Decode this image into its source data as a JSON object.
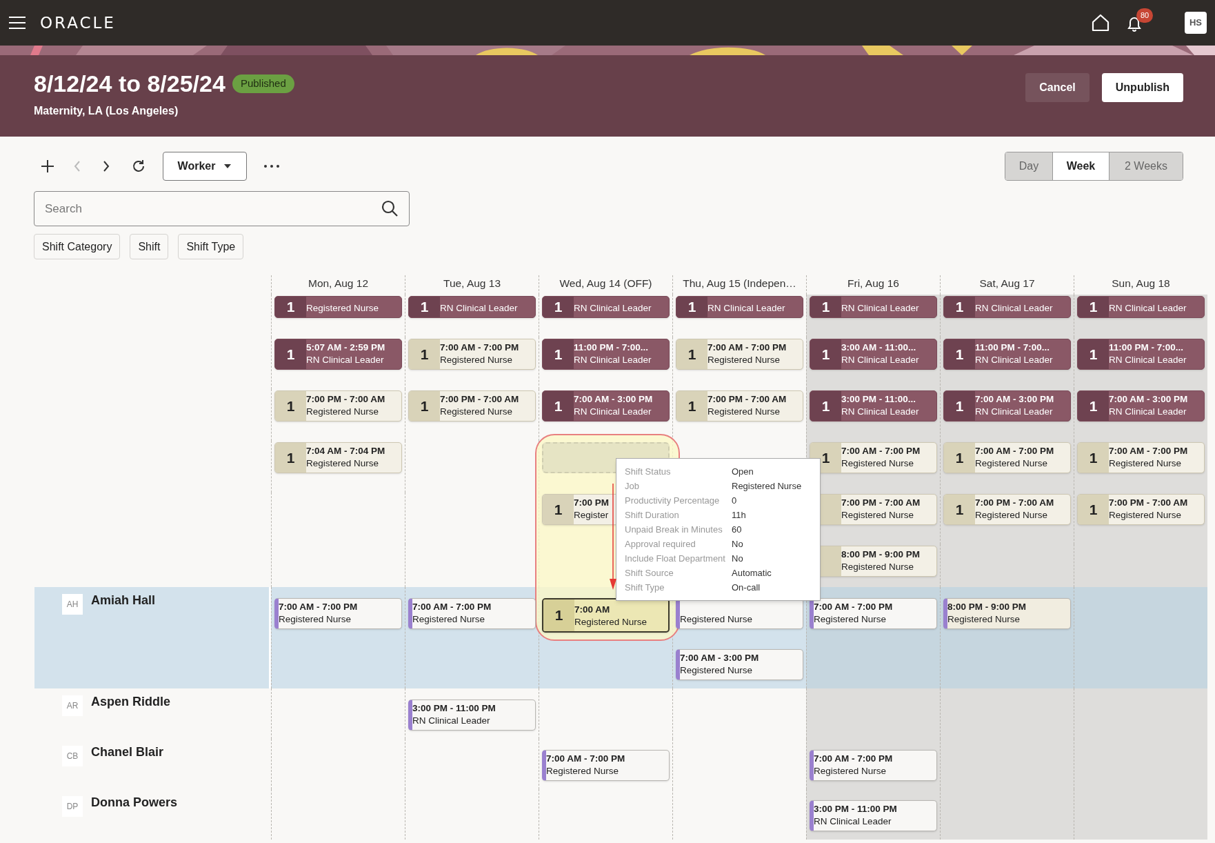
{
  "top_bar": {
    "logo": "ORACLE",
    "notifications": "80",
    "user_initials": "HS"
  },
  "header": {
    "title": "8/12/24 to 8/25/24",
    "status": "Published",
    "subtitle": "Maternity, LA (Los Angeles)",
    "actions": [
      {
        "label": "Cancel",
        "kind": "secondary"
      },
      {
        "label": "Unpublish",
        "kind": "primary"
      }
    ]
  },
  "toolbar": {
    "previous_disabled": true,
    "view_by": "Worker",
    "views": [
      {
        "label": "Day",
        "selected": false
      },
      {
        "label": "Week",
        "selected": true
      },
      {
        "label": "2 Weeks",
        "selected": false
      }
    ]
  },
  "search": {
    "placeholder": "Search"
  },
  "filters": [
    "Shift Category",
    "Shift",
    "Shift Type"
  ],
  "days": [
    {
      "label": "Mon, Aug 12",
      "shaded": false
    },
    {
      "label": "Tue, Aug 13",
      "shaded": false
    },
    {
      "label": "Wed, Aug 14 (OFF)",
      "shaded": false
    },
    {
      "label": "Thu, Aug 15 (Indepen…",
      "shaded": false
    },
    {
      "label": "Fri, Aug 16",
      "shaded": true
    },
    {
      "label": "Sat, Aug 17",
      "shaded": true
    },
    {
      "label": "Sun, Aug 18",
      "shaded": true
    }
  ],
  "open_shift_lanes": [
    {
      "cells": [
        {
          "kind": "leader",
          "count": "1",
          "job": "Registered Nurse"
        },
        {
          "kind": "leader",
          "count": "1",
          "job": "RN Clinical Leader"
        },
        {
          "kind": "leader",
          "count": "1",
          "job": "RN Clinical Leader"
        },
        {
          "kind": "leader",
          "count": "1",
          "job": "RN Clinical Leader"
        },
        {
          "kind": "leader",
          "count": "1",
          "job": "RN Clinical Leader"
        },
        {
          "kind": "leader",
          "count": "1",
          "job": "RN Clinical Leader"
        },
        {
          "kind": "leader",
          "count": "1",
          "job": "RN Clinical Leader"
        }
      ]
    },
    {
      "cells": [
        {
          "kind": "leader",
          "count": "1",
          "time": "5:07 AM - 2:59 PM",
          "job": "RN Clinical Leader"
        },
        {
          "kind": "nurse",
          "count": "1",
          "time": "7:00 AM - 7:00 PM",
          "job": "Registered Nurse"
        },
        {
          "kind": "leader",
          "count": "1",
          "time": "11:00 PM - 7:00...",
          "job": "RN Clinical Leader"
        },
        {
          "kind": "nurse",
          "count": "1",
          "time": "7:00 AM - 7:00 PM",
          "job": "Registered Nurse"
        },
        {
          "kind": "leader",
          "count": "1",
          "time": "3:00 AM - 11:00...",
          "job": "RN Clinical Leader"
        },
        {
          "kind": "leader",
          "count": "1",
          "time": "11:00 PM - 7:00...",
          "job": "RN Clinical Leader"
        },
        {
          "kind": "leader",
          "count": "1",
          "time": "11:00 PM - 7:00...",
          "job": "RN Clinical Leader"
        }
      ]
    },
    {
      "cells": [
        {
          "kind": "nurse",
          "count": "1",
          "time": "7:00 PM - 7:00 AM",
          "job": "Registered Nurse"
        },
        {
          "kind": "nurse",
          "count": "1",
          "time": "7:00 PM - 7:00 AM",
          "job": "Registered Nurse"
        },
        {
          "kind": "leader",
          "count": "1",
          "time": "7:00 AM - 3:00 PM",
          "job": "RN Clinical Leader"
        },
        {
          "kind": "nurse",
          "count": "1",
          "time": "7:00 PM - 7:00 AM",
          "job": "Registered Nurse"
        },
        {
          "kind": "leader",
          "count": "1",
          "time": "3:00 PM - 11:00...",
          "job": "RN Clinical Leader"
        },
        {
          "kind": "leader",
          "count": "1",
          "time": "7:00 AM - 3:00 PM",
          "job": "RN Clinical Leader"
        },
        {
          "kind": "leader",
          "count": "1",
          "time": "7:00 AM - 3:00 PM",
          "job": "RN Clinical Leader"
        }
      ]
    },
    {
      "cells": [
        {
          "kind": "nurse",
          "count": "1",
          "time": "7:04 AM - 7:04 PM",
          "job": "Registered Nurse"
        },
        {
          "kind": "empty"
        },
        {
          "kind": "drop-zone"
        },
        {
          "kind": "empty"
        },
        {
          "kind": "nurse",
          "count": "1",
          "time": "7:00 AM - 7:00 PM",
          "job": "Registered Nurse"
        },
        {
          "kind": "nurse",
          "count": "1",
          "time": "7:00 AM - 7:00 PM",
          "job": "Registered Nurse"
        },
        {
          "kind": "nurse",
          "count": "1",
          "time": "7:00 AM - 7:00 PM",
          "job": "Registered Nurse"
        }
      ]
    },
    {
      "cells": [
        {
          "kind": "empty"
        },
        {
          "kind": "empty"
        },
        {
          "kind": "nurse",
          "count": "1",
          "time": "7:00 PM",
          "job": "Register"
        },
        {
          "kind": "empty"
        },
        {
          "kind": "nurse",
          "time": "7:00 PM - 7:00 AM",
          "job": "Registered Nurse"
        },
        {
          "kind": "nurse",
          "count": "1",
          "time": "7:00 PM - 7:00 AM",
          "job": "Registered Nurse"
        },
        {
          "kind": "nurse",
          "count": "1",
          "time": "7:00 PM - 7:00 AM",
          "job": "Registered Nurse"
        }
      ]
    },
    {
      "cells": [
        {
          "kind": "empty"
        },
        {
          "kind": "empty"
        },
        {
          "kind": "empty"
        },
        {
          "kind": "empty"
        },
        {
          "kind": "nurse",
          "time": "8:00 PM - 9:00 PM",
          "job": "Registered Nurse"
        },
        {
          "kind": "empty"
        },
        {
          "kind": "empty"
        }
      ]
    }
  ],
  "workers": [
    {
      "initials": "AH",
      "name": "Amiah Hall",
      "selected": true,
      "cells": [
        {
          "shifts": [
            {
              "kind": "assigned",
              "time": "7:00 AM - 7:00 PM",
              "job": "Registered Nurse"
            }
          ]
        },
        {
          "shifts": [
            {
              "kind": "assigned",
              "time": "7:00 AM - 7:00 PM",
              "job": "Registered Nurse"
            }
          ]
        },
        {
          "shifts": [
            {
              "kind": "dragged",
              "count": "1",
              "time": "7:00 AM",
              "job": "Registered Nurse"
            }
          ]
        },
        {
          "shifts": [
            {
              "kind": "assigned",
              "job": "Registered Nurse"
            },
            {
              "kind": "assigned",
              "time": "7:00 AM - 3:00 PM",
              "job": "Registered Nurse"
            }
          ]
        },
        {
          "shifts": [
            {
              "kind": "assigned",
              "time": "7:00 AM - 7:00 PM",
              "job": "Registered Nurse"
            }
          ]
        },
        {
          "shifts": [
            {
              "kind": "tinted",
              "time": "8:00 PM - 9:00 PM",
              "job": "Registered Nurse"
            }
          ]
        },
        null
      ]
    },
    {
      "initials": "AR",
      "name": "Aspen Riddle",
      "selected": false,
      "cells": [
        null,
        {
          "shifts": [
            {
              "kind": "assigned",
              "time": "3:00 PM - 11:00 PM",
              "job": "RN Clinical Leader"
            }
          ]
        },
        null,
        null,
        null,
        null,
        null
      ]
    },
    {
      "initials": "CB",
      "name": "Chanel Blair",
      "selected": false,
      "cells": [
        null,
        null,
        {
          "shifts": [
            {
              "kind": "assigned",
              "time": "7:00 AM - 7:00 PM",
              "job": "Registered Nurse"
            }
          ]
        },
        null,
        {
          "shifts": [
            {
              "kind": "assigned",
              "time": "7:00 AM - 7:00 PM",
              "job": "Registered Nurse"
            }
          ]
        },
        null,
        null
      ]
    },
    {
      "initials": "DP",
      "name": "Donna Powers",
      "selected": false,
      "cells": [
        null,
        null,
        null,
        null,
        {
          "shifts": [
            {
              "kind": "assigned",
              "time": "3:00 PM - 11:00 PM",
              "job": "RN Clinical Leader"
            }
          ]
        },
        null,
        null
      ]
    }
  ],
  "tooltip": {
    "rows": [
      {
        "label": "Shift Status",
        "value": "Open"
      },
      {
        "label": "Job",
        "value": "Registered Nurse"
      },
      {
        "label": "Productivity Percentage",
        "value": "0"
      },
      {
        "label": "Shift Duration",
        "value": "11h"
      },
      {
        "label": "Unpaid Break in Minutes",
        "value": "60"
      },
      {
        "label": "Approval required",
        "value": "No"
      },
      {
        "label": "Include Float Department",
        "value": "No"
      },
      {
        "label": "Shift Source",
        "value": "Automatic"
      },
      {
        "label": "Shift Type",
        "value": "On-call"
      }
    ]
  }
}
